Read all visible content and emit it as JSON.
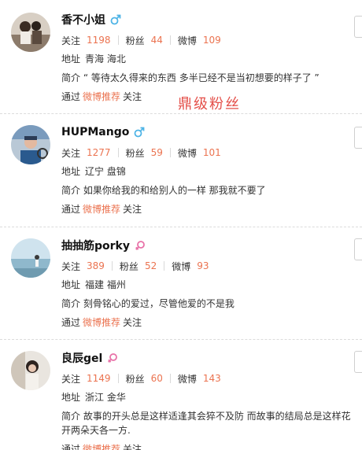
{
  "users": [
    {
      "name": "香不小姐",
      "gender": "male",
      "follow_label": "关注",
      "follow_count": "1198",
      "fans_label": "粉丝",
      "fans_count": "44",
      "weibo_label": "微博",
      "weibo_count": "109",
      "location_label": "地址",
      "location": "青海 海北",
      "bio_label": "简介",
      "bio": "“ 等待太久得来的东西 多半已经不是当初想要的样子了 ”",
      "via_prefix": "通过",
      "via_link": "微博推荐",
      "via_suffix": "关注"
    },
    {
      "name": "HUPMango",
      "gender": "male",
      "follow_label": "关注",
      "follow_count": "1277",
      "fans_label": "粉丝",
      "fans_count": "59",
      "weibo_label": "微博",
      "weibo_count": "101",
      "location_label": "地址",
      "location": "辽宁 盘锦",
      "bio_label": "简介",
      "bio": "如果你给我的和给别人的一样 那我就不要了",
      "via_prefix": "通过",
      "via_link": "微博推荐",
      "via_suffix": "关注"
    },
    {
      "name": "抽抽筋porky",
      "gender": "female",
      "follow_label": "关注",
      "follow_count": "389",
      "fans_label": "粉丝",
      "fans_count": "52",
      "weibo_label": "微博",
      "weibo_count": "93",
      "location_label": "地址",
      "location": "福建 福州",
      "bio_label": "简介",
      "bio": "刻骨铭心的爱过，尽管他爱的不是我",
      "via_prefix": "通过",
      "via_link": "微博推荐",
      "via_suffix": "关注"
    },
    {
      "name": "良辰gel",
      "gender": "female",
      "follow_label": "关注",
      "follow_count": "1149",
      "fans_label": "粉丝",
      "fans_count": "60",
      "weibo_label": "微博",
      "weibo_count": "143",
      "location_label": "地址",
      "location": "浙江 金华",
      "bio_label": "简介",
      "bio": "故事的开头总是这样适逢其会猝不及防 而故事的结局总是这样花开两朵天各一方.",
      "via_prefix": "通过",
      "via_link": "微博推荐",
      "via_suffix": "关注"
    }
  ],
  "watermark": "鼎级粉丝",
  "colors": {
    "accent": "#eb7350",
    "male": "#4fb4e6",
    "female": "#e872a8",
    "watermark": "#e4504a"
  },
  "icons": {
    "male": "male-gender-icon",
    "female": "female-gender-icon"
  }
}
